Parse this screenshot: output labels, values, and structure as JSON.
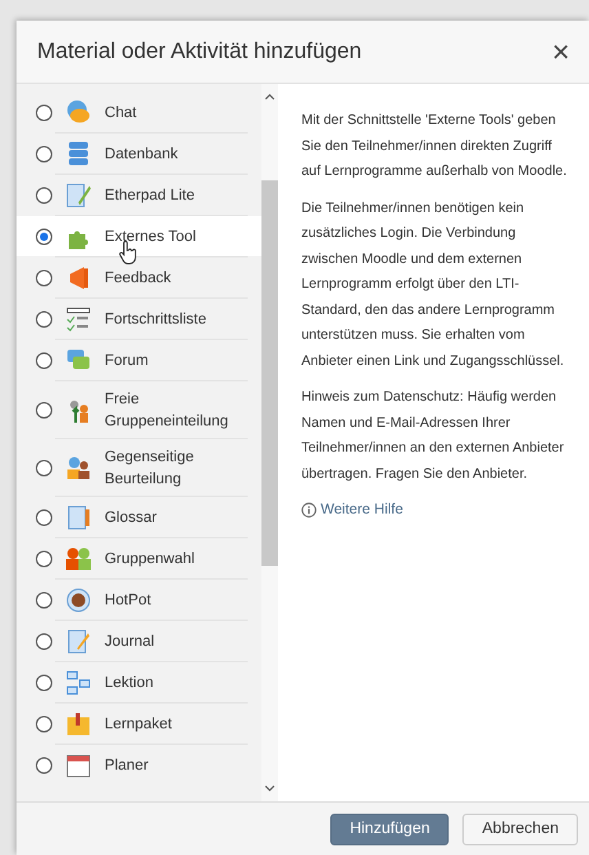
{
  "dialog": {
    "title": "Material oder Aktivität hinzufügen",
    "close": "×"
  },
  "activities": [
    {
      "label": "Chat",
      "selected": false
    },
    {
      "label": "Datenbank",
      "selected": false
    },
    {
      "label": "Etherpad Lite",
      "selected": false
    },
    {
      "label": "Externes Tool",
      "selected": true
    },
    {
      "label": "Feedback",
      "selected": false
    },
    {
      "label": "Fortschrittsliste",
      "selected": false
    },
    {
      "label": "Forum",
      "selected": false
    },
    {
      "label": "Freie Gruppeneinteilung",
      "selected": false
    },
    {
      "label": "Gegenseitige Beurteilung",
      "selected": false
    },
    {
      "label": "Glossar",
      "selected": false
    },
    {
      "label": "Gruppenwahl",
      "selected": false
    },
    {
      "label": "HotPot",
      "selected": false
    },
    {
      "label": "Journal",
      "selected": false
    },
    {
      "label": "Lektion",
      "selected": false
    },
    {
      "label": "Lernpaket",
      "selected": false
    },
    {
      "label": "Planer",
      "selected": false
    }
  ],
  "description": {
    "paragraphs": [
      "Mit der Schnittstelle 'Externe Tools' geben Sie den Teilnehmer/innen direkten Zugriff auf Lernprogramme außerhalb von Moodle.",
      "Die Teilnehmer/innen benötigen kein zusätzliches Login. Die Verbindung zwischen Moodle und dem externen Lernprogramm erfolgt über den LTI-Standard, den das andere Lernprogramm unterstützen muss. Sie erhalten vom Anbieter einen Link und Zugangsschlüssel.",
      "Hinweis zum Datenschutz: Häufig werden Namen und E-Mail-Adressen Ihrer Teilnehmer/innen an den externen Anbieter übertragen. Fragen Sie den Anbieter."
    ],
    "help_link": "Weitere Hilfe"
  },
  "buttons": [
    {
      "label": "Hinzufügen",
      "kind": "primary"
    },
    {
      "label": "Abbrechen",
      "kind": "secondary"
    }
  ]
}
